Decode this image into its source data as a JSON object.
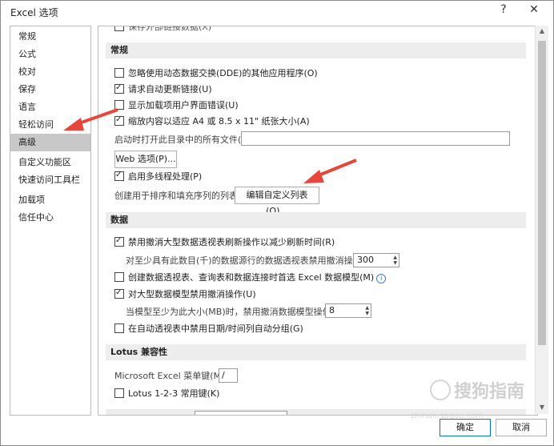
{
  "window": {
    "title": "Excel 选项",
    "help_icon": "?",
    "close_icon": "✕"
  },
  "nav": {
    "items": [
      {
        "label": "常规",
        "active": false
      },
      {
        "label": "公式",
        "active": false
      },
      {
        "label": "校对",
        "active": false
      },
      {
        "label": "保存",
        "active": false
      },
      {
        "label": "语言",
        "active": false
      },
      {
        "label": "轻松访问",
        "active": false
      },
      {
        "label": "高级",
        "active": true
      },
      {
        "label": "自定义功能区",
        "active": false
      },
      {
        "label": "快速访问工具栏",
        "active": false
      },
      {
        "label": "加载项",
        "active": false
      },
      {
        "label": "信任中心",
        "active": false
      }
    ]
  },
  "content": {
    "top_partial": "保存外部链接数据(X)",
    "general": {
      "header": "常规",
      "ignore_dde": "忽略使用动态数据交换(DDE)的其他应用程序(O)",
      "ask_update_links": "请求自动更新链接(U)",
      "show_addin_errors": "显示加载项用户界面错误(U)",
      "scale_content": "缩放内容以适应 A4 或 8.5 x 11\" 纸张大小(A)",
      "startup_open_label": "启动时打开此目录中的所有文件(L):",
      "startup_open_value": "",
      "web_options": "Web 选项(P)...",
      "multithread": "启用多线程处理(P)",
      "custom_lists_label": "创建用于排序和填充序列的列表:",
      "edit_custom_lists": "编辑自定义列表(O)..."
    },
    "data": {
      "header": "数据",
      "disable_undo_pivot": "禁用撤消大型数据透视表刷新操作以减少刷新时间(R)",
      "pivot_rows_label": "对至少具有此数目(千)的数据源行的数据透视表禁用撤消操作(N):",
      "pivot_rows_value": "300",
      "prefer_excel_model": "创建数据透视表、查询表和数据连接时首选 Excel 数据模型(M)",
      "disable_undo_model": "对大型数据模型禁用撤消操作(U)",
      "model_size_label": "当模型至少为此大小(MB)时，禁用撤消数据模型操作(L):",
      "model_size_value": "8",
      "disable_date_group": "在自动透视表中禁用日期/时间列自动分组(G)"
    },
    "lotus": {
      "header": "Lotus 兼容性",
      "menu_key_label": "Microsoft Excel 菜单键(M):",
      "menu_key_value": "/",
      "lotus_keys": "Lotus 1-2-3 常用键(K)"
    }
  },
  "footer": {
    "ok": "确定",
    "cancel": "取消"
  },
  "watermark": {
    "text": "搜狗指南",
    "url": "zhinan.sogou.com"
  },
  "colors": {
    "accent": "#0078d7",
    "arrow": "#e8453c",
    "nav_active": "#c8c8c8"
  }
}
